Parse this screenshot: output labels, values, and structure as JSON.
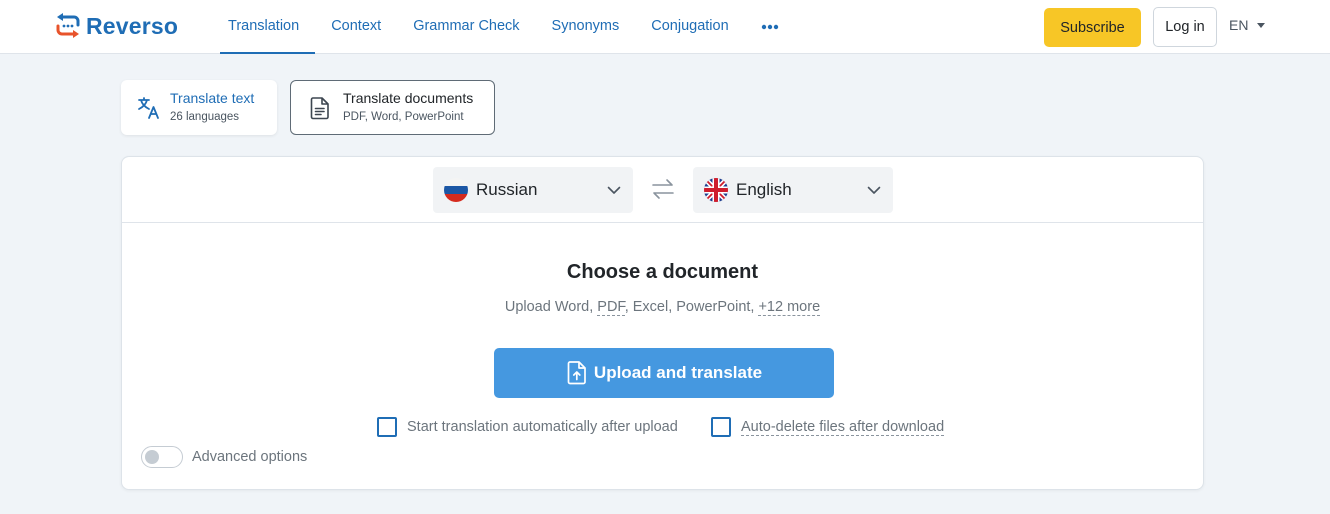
{
  "header": {
    "logo_text": "Reverso",
    "nav": [
      {
        "label": "Translation",
        "active": true
      },
      {
        "label": "Context",
        "active": false
      },
      {
        "label": "Grammar Check",
        "active": false
      },
      {
        "label": "Synonyms",
        "active": false
      },
      {
        "label": "Conjugation",
        "active": false
      }
    ],
    "more_icon": "more-horizontal-icon",
    "subscribe_label": "Subscribe",
    "login_label": "Log in",
    "ui_language": "EN"
  },
  "modes": {
    "text": {
      "title": "Translate text",
      "subtitle": "26 languages",
      "icon": "translate-icon"
    },
    "documents": {
      "title": "Translate documents",
      "subtitle": "PDF, Word, PowerPoint",
      "icon": "document-icon"
    }
  },
  "languages": {
    "source": {
      "name": "Russian",
      "flag": "russia-flag-icon"
    },
    "target": {
      "name": "English",
      "flag": "uk-flag-icon"
    },
    "swap_icon": "swap-icon"
  },
  "upload": {
    "title": "Choose a document",
    "formats_prefix": "Upload Word, ",
    "formats_pdf": "PDF",
    "formats_middle": ", Excel, PowerPoint, ",
    "formats_more": "+12 more",
    "button_label": "Upload and translate",
    "auto_translate_label": "Start translation automatically after upload",
    "auto_delete_label": "Auto-delete files after download",
    "advanced_label": "Advanced options"
  },
  "colors": {
    "brand_blue": "#1f6db5",
    "upload_button": "#4598e0",
    "subscribe_yellow": "#f7c626",
    "logo_orange": "#e8532b",
    "page_background": "#f0f4f8"
  }
}
